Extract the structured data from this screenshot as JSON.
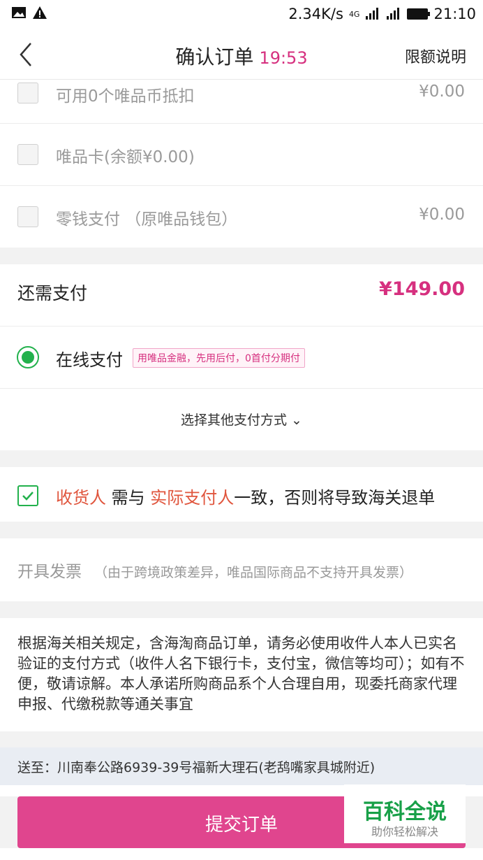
{
  "status_bar": {
    "speed": "2.34K/s",
    "network": "4G",
    "time": "21:10"
  },
  "header": {
    "title": "确认订单",
    "timer": "19:53",
    "limit_link": "限额说明"
  },
  "deductions": [
    {
      "label": "可用0个唯品币抵扣",
      "amount": "¥0.00"
    },
    {
      "label": "唯品卡(余额¥0.00)",
      "amount": ""
    },
    {
      "label": "零钱支付 （原唯品钱包）",
      "amount": "¥0.00"
    }
  ],
  "amount_due": {
    "label": "还需支付",
    "value": "¥149.00"
  },
  "payment": {
    "online_label": "在线支付",
    "promo_tag": "用唯品金融，先用后付，0首付分期付",
    "other_methods": "选择其他支付方式 ⌄"
  },
  "customs_notice": {
    "part1": "收货人",
    "part2": " 需与 ",
    "part3": "实际支付人",
    "part4": "一致，否则将导致海关退单"
  },
  "invoice": {
    "label": "开具发票",
    "note": "（由于跨境政策差异，唯品国际商品不支持开具发票）"
  },
  "policy_text": "根据海关相关规定，含海淘商品订单，请务必使用收件人本人已实名验证的支付方式（收件人名下银行卡，支付宝，微信等均可）；如有不便，敬请谅解。本人承诺所购商品系个人合理自用，现委托商家代理申报、代缴税款等通关事宜",
  "address": "送至：川南奉公路6939-39号福新大理石(老鸹嘴家具城附近)",
  "submit_label": "提交订单",
  "watermark": {
    "title": "百科全说",
    "subtitle": "助你轻松解决"
  },
  "colors": {
    "accent": "#d6307f",
    "submit": "#e0458e",
    "green": "#22b14c",
    "warning_red": "#e0553d"
  }
}
